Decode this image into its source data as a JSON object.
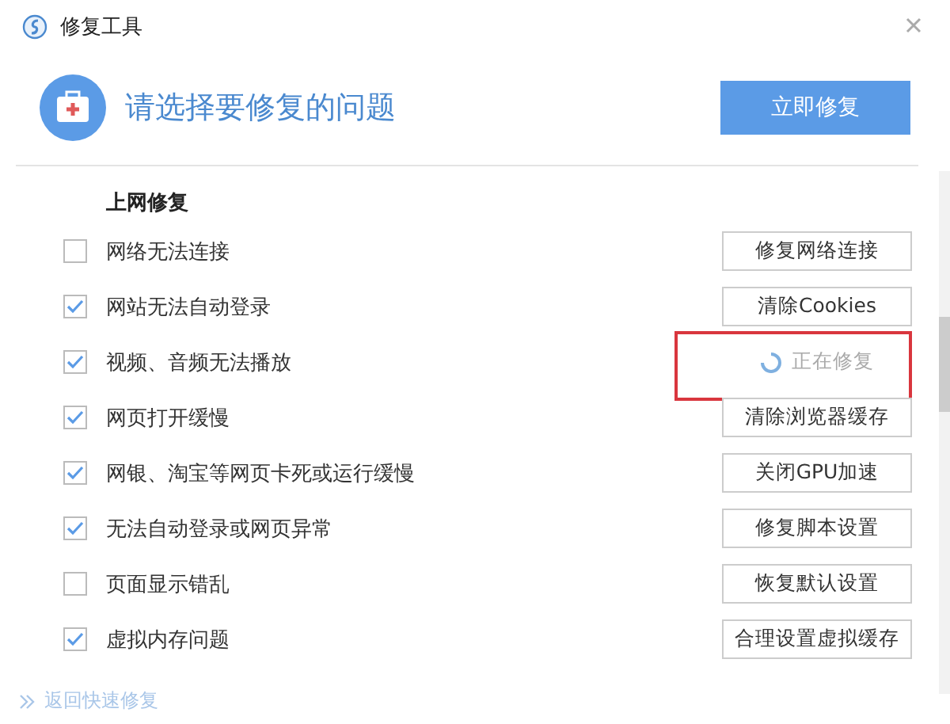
{
  "window": {
    "title": "修复工具"
  },
  "header": {
    "prompt": "请选择要修复的问题",
    "action": "立即修复"
  },
  "section": {
    "title": "上网修复"
  },
  "items": [
    {
      "label": "网络无法连接",
      "checked": false,
      "kind": "button",
      "action": "修复网络连接",
      "highlighted": false
    },
    {
      "label": "网站无法自动登录",
      "checked": true,
      "kind": "button",
      "action": "清除Cookies",
      "highlighted": false
    },
    {
      "label": "视频、音频无法播放",
      "checked": true,
      "kind": "progress",
      "action": "正在修复",
      "highlighted": true
    },
    {
      "label": "网页打开缓慢",
      "checked": true,
      "kind": "button",
      "action": "清除浏览器缓存",
      "highlighted": false
    },
    {
      "label": "网银、淘宝等网页卡死或运行缓慢",
      "checked": true,
      "kind": "button",
      "action": "关闭GPU加速",
      "highlighted": false
    },
    {
      "label": "无法自动登录或网页异常",
      "checked": true,
      "kind": "button",
      "action": "修复脚本设置",
      "highlighted": false
    },
    {
      "label": "页面显示错乱",
      "checked": false,
      "kind": "button",
      "action": "恢复默认设置",
      "highlighted": false
    },
    {
      "label": "虚拟内存问题",
      "checked": true,
      "kind": "button",
      "action": "合理设置虚拟缓存",
      "highlighted": false
    }
  ],
  "footer": {
    "link": "返回快速修复"
  }
}
